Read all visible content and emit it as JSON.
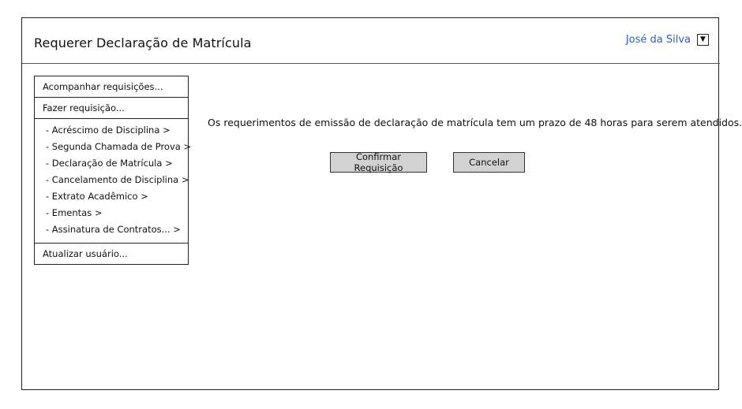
{
  "header": {
    "title": "Requerer Declaração de Matrícula",
    "user_name": "José da Silva",
    "dropdown_glyph": "▼"
  },
  "sidebar": {
    "items": [
      {
        "label": "Acompanhar requisições..."
      },
      {
        "label": "Fazer requisição..."
      }
    ],
    "sub_items": [
      {
        "label": "- Acréscimo de Disciplina >"
      },
      {
        "label": "- Segunda Chamada de Prova >"
      },
      {
        "label": "- Declaração de Matrícula >"
      },
      {
        "label": "- Cancelamento de Disciplina >"
      },
      {
        "label": "- Extrato Acadêmico >"
      },
      {
        "label": "- Ementas >"
      },
      {
        "label": "- Assinatura de Contratos... >"
      }
    ],
    "footer_item": {
      "label": "Atualizar usuário..."
    }
  },
  "main": {
    "message": "Os requerimentos de emissão de declaração de matrícula tem um prazo de 48 horas para serem atendidos.",
    "confirm_label": "Confirmar Requisição",
    "cancel_label": "Cancelar"
  },
  "colors": {
    "user_link": "#2a5fd0",
    "button_bg": "#d2d2d2"
  }
}
